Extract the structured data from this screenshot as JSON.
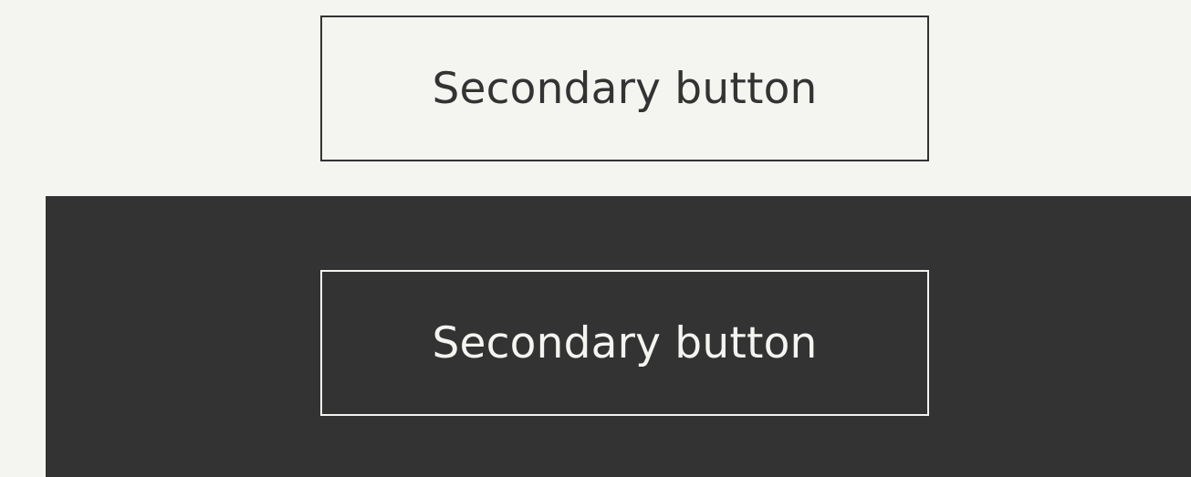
{
  "light_section": {
    "secondary_button_label": "Secondary button"
  },
  "dark_section": {
    "secondary_button_label": "Secondary button"
  },
  "colors": {
    "light_background": "#f4f5f1",
    "dark_background": "#333333",
    "light_text": "#f4f5f1",
    "dark_text": "#333333"
  }
}
